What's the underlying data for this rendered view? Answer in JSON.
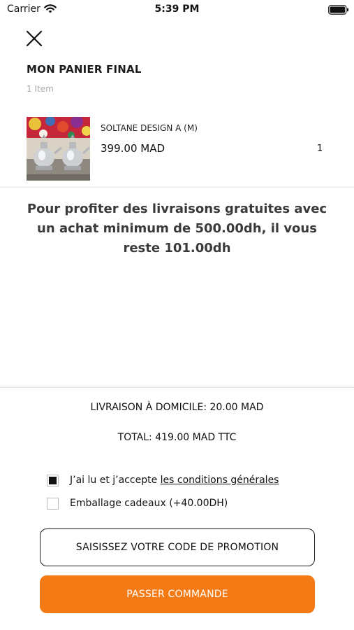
{
  "status_bar": {
    "carrier": "Carrier",
    "time": "5:39 PM",
    "icons": [
      "wifi-icon",
      "battery-icon"
    ]
  },
  "header": {
    "close_icon": "close-icon",
    "title": "MON PANIER FINAL",
    "item_count": "1 Item"
  },
  "cart": {
    "items": [
      {
        "name": "SOLTANE DESIGN A (M)",
        "price": "399.00 MAD",
        "quantity": "1"
      }
    ]
  },
  "free_shipping_message": "Pour profiter des livraisons gratuites avec un achat minimum de 500.00dh, il vous reste 101.00dh",
  "summary": {
    "delivery": "LIVRAISON À DOMICILE: 20.00 MAD",
    "total": "TOTAL: 419.00 MAD TTC"
  },
  "options": {
    "terms_prefix": "J’ai lu et j’accepte ",
    "terms_link": "les conditions générales",
    "terms_checked": true,
    "gift_label": "Emballage cadeaux (+40.00DH)",
    "gift_checked": false
  },
  "buttons": {
    "promo": "SAISISSEZ VOTRE CODE DE PROMOTION",
    "order": "PASSER COMMANDE"
  },
  "colors": {
    "accent": "#f47a16",
    "text": "#1c1c1c",
    "muted": "#a9a9a9"
  }
}
